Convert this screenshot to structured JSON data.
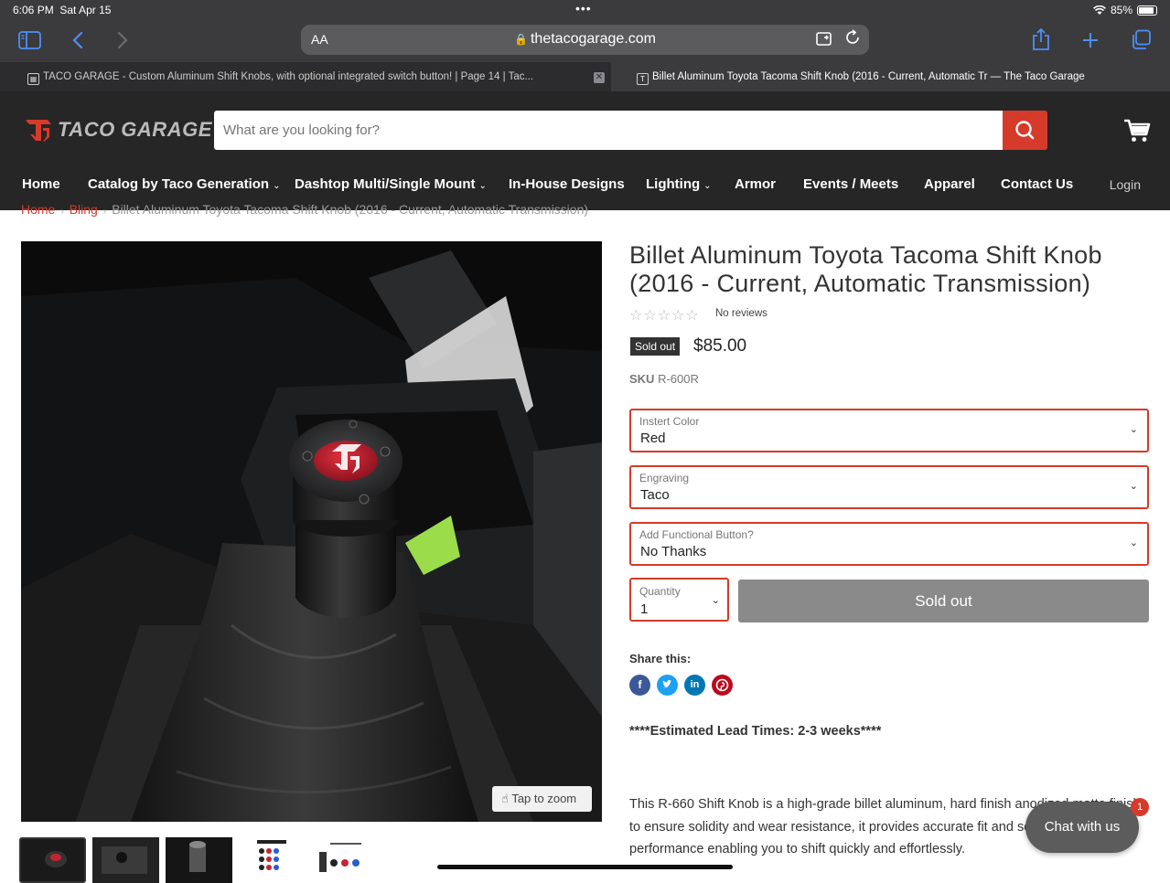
{
  "status": {
    "time": "6:06 PM",
    "date": "Sat Apr 15",
    "battery": "85%"
  },
  "browser": {
    "text_size": "AA",
    "url": "thetacogarage.com",
    "tabs": [
      {
        "label": "TACO GARAGE - Custom Aluminum Shift Knobs, with optional integrated switch button! | Page 14 | Tac...",
        "active": false
      },
      {
        "label": "Billet Aluminum Toyota Tacoma Shift Knob (2016 - Current, Automatic Tr — The Taco Garage",
        "active": true
      }
    ]
  },
  "store": {
    "logo_text": "TACO GARAGE",
    "search_placeholder": "What are you looking for?",
    "nav": [
      "Home",
      "Catalog by Taco Generation",
      "Dashtop Multi/Single Mount",
      "In-House Designs",
      "Lighting",
      "Armor",
      "Events / Meets",
      "Apparel",
      "Contact Us"
    ],
    "login": "Login",
    "accent": "#d63a2a"
  },
  "breadcrumb": [
    "Home",
    "Bling",
    "Billet Aluminum Toyota Tacoma Shift Knob (2016 - Current, Automatic Transmission)"
  ],
  "product": {
    "title": "Billet Aluminum Toyota Tacoma Shift Knob (2016 - Current, Automatic Transmission)",
    "reviews": "No reviews",
    "badge": "Sold out",
    "price": "$85.00",
    "sku_label": "SKU",
    "sku": "R-600R",
    "options": [
      {
        "label": "Instert Color",
        "value": "Red"
      },
      {
        "label": "Engraving",
        "value": "Taco"
      },
      {
        "label": "Add Functional Button?",
        "value": "No Thanks"
      }
    ],
    "quantity_label": "Quantity",
    "quantity": "1",
    "button": "Sold out",
    "zoom": "Tap to zoom",
    "share_label": "Share this:",
    "lead_time": "****Estimated Lead Times: 2-3 weeks****",
    "description": "This R-660 Shift Knob is a high-grade billet aluminum, hard finish anodized matte finish to ensure solidity and wear resistance, it provides accurate fit and seamless performance enabling you to shift quickly and effortlessly."
  },
  "chat": {
    "label": "Chat with us",
    "count": "1"
  }
}
